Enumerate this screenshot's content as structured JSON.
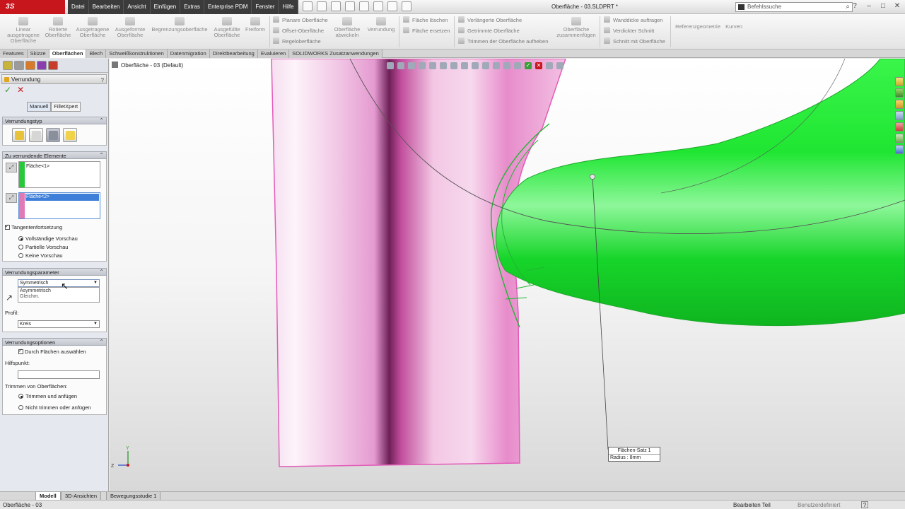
{
  "app": {
    "logo": "3S SOLIDWORKS",
    "menu": [
      "Datei",
      "Bearbeiten",
      "Ansicht",
      "Einfügen",
      "Extras",
      "Enterprise PDM",
      "Fenster",
      "Hilfe"
    ],
    "document_title": "Oberfläche - 03.SLDPRT *",
    "search_placeholder": "Befehlssuche",
    "search_icon": "magnifier-icon",
    "help_glyph": "?",
    "window_buttons": [
      "–",
      "□",
      "✕"
    ]
  },
  "ribbon": {
    "big_buttons": [
      "Linear ausgetragene Oberfläche",
      "Rotierte Oberfläche",
      "Ausgetragene Oberfläche",
      "Ausgeformte Oberfläche",
      "Begrenzungsoberfläche",
      "Ausgefüllte Oberfläche",
      "Freiform",
      "Oberfläche abwickeln",
      "Verrundung",
      "Oberfläche zusammenfügen",
      "Referenzgeometrie",
      "Kurven"
    ],
    "small_buttons": [
      "Planare Oberfläche",
      "Offset-Oberfläche",
      "Regeloberfläche",
      "Fläche löschen",
      "Fläche ersetzen",
      "Verlängerte Oberfläche",
      "Getrimmte Oberfläche",
      "Trimmen der Oberfläche aufheben",
      "Wanddicke auftragen",
      "Verdickter Schnitt",
      "Schnitt mit Oberfläche"
    ]
  },
  "command_tabs": [
    "Features",
    "Skizze",
    "Oberflächen",
    "Blech",
    "Schweißkonstruktionen",
    "Datenmigration",
    "Direktbearbeitung",
    "Evaluieren",
    "SOLIDWORKS Zusatzanwendungen"
  ],
  "active_command_tab": "Oberflächen",
  "property_manager": {
    "title": "Verrundung",
    "help": "?",
    "ok": "✓",
    "cancel": "✕",
    "mode_buttons": [
      "Manuell",
      "FilletXpert"
    ],
    "sections": {
      "type": "Verrundungstyp",
      "items": "Zu verrundende Elemente",
      "params": "Verrundungsparameter",
      "options": "Verrundungsoptionen"
    },
    "face1": "Fläche<1>",
    "face2": "Fläche<2>",
    "tangent_label": "Tangentenfortsetzung",
    "preview_options": [
      "Vollständige Vorschau",
      "Partielle Vorschau",
      "Keine Vorschau"
    ],
    "fillet_method_selected": "Symmetrisch",
    "fillet_method_options": [
      "Asymmetrisch",
      "Gleichm."
    ],
    "profile_label": "Profil:",
    "profile_value": "Kreis",
    "through_faces_label": "Durch Flächen auswählen",
    "helppoint_label": "Hilfspunkt:",
    "trim_label": "Trimmen von Oberflächen:",
    "trim_options": [
      "Trimmen und anfügen",
      "Nicht trimmen oder anfügen"
    ]
  },
  "graphics": {
    "tree_breadcrumb": "Oberfläche - 03  (Default)",
    "callout_title": "Flächen-Satz 1",
    "callout_value": "Radius : 8mm",
    "triad_labels": [
      "Y",
      "Z"
    ]
  },
  "bottom_tabs": [
    "Modell",
    "3D-Ansichten",
    "Bewegungsstudie 1"
  ],
  "status": {
    "left": "Oberfläche - 03",
    "mode": "Bearbeiten Teil",
    "units": "Benutzerdefiniert",
    "help": "?"
  }
}
